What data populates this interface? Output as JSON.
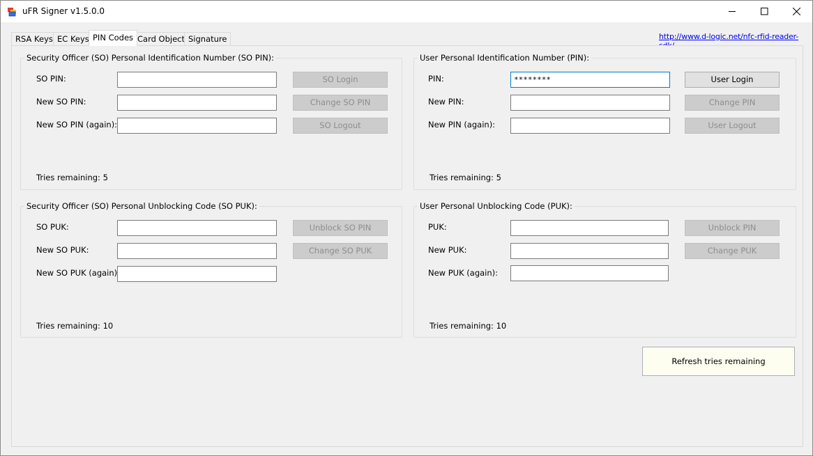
{
  "window": {
    "title": "uFR Signer v1.5.0.0"
  },
  "tabs": [
    "RSA Keys",
    "EC Keys",
    "PIN Codes",
    "Card Objects",
    "Signature"
  ],
  "link": "http://www.d-logic.net/nfc-rfid-reader-sdk/",
  "so_pin": {
    "title": "Security Officer (SO) Personal Identification Number (SO PIN):",
    "pin_label": "SO PIN:",
    "new_label": "New SO PIN:",
    "new_again_label": "New SO PIN (again):",
    "pin_value": "",
    "new_value": "",
    "new_again_value": "",
    "login_button": "SO Login",
    "change_button": "Change SO PIN",
    "logout_button": "SO Logout",
    "tries": "Tries remaining: 5"
  },
  "user_pin": {
    "title": "User Personal Identification Number (PIN):",
    "pin_label": "PIN:",
    "new_label": "New PIN:",
    "new_again_label": "New PIN (again):",
    "pin_value": "********",
    "new_value": "",
    "new_again_value": "",
    "login_button": "User Login",
    "change_button": "Change PIN",
    "logout_button": "User Logout",
    "tries": "Tries remaining: 5"
  },
  "so_puk": {
    "title": "Security Officer (SO) Personal Unblocking Code (SO PUK):",
    "puk_label": "SO PUK:",
    "new_label": "New SO PUK:",
    "new_again_label": "New SO PUK (again):",
    "puk_value": "",
    "new_value": "",
    "new_again_value": "",
    "unblock_button": "Unblock SO PIN",
    "change_button": "Change SO PUK",
    "tries": "Tries remaining: 10"
  },
  "user_puk": {
    "title": "User Personal Unblocking Code (PUK):",
    "puk_label": "PUK:",
    "new_label": "New PUK:",
    "new_again_label": "New PUK (again):",
    "puk_value": "",
    "new_value": "",
    "new_again_value": "",
    "unblock_button": "Unblock PIN",
    "change_button": "Change PUK",
    "tries": "Tries remaining: 10"
  },
  "refresh_button": "Refresh tries remaining"
}
